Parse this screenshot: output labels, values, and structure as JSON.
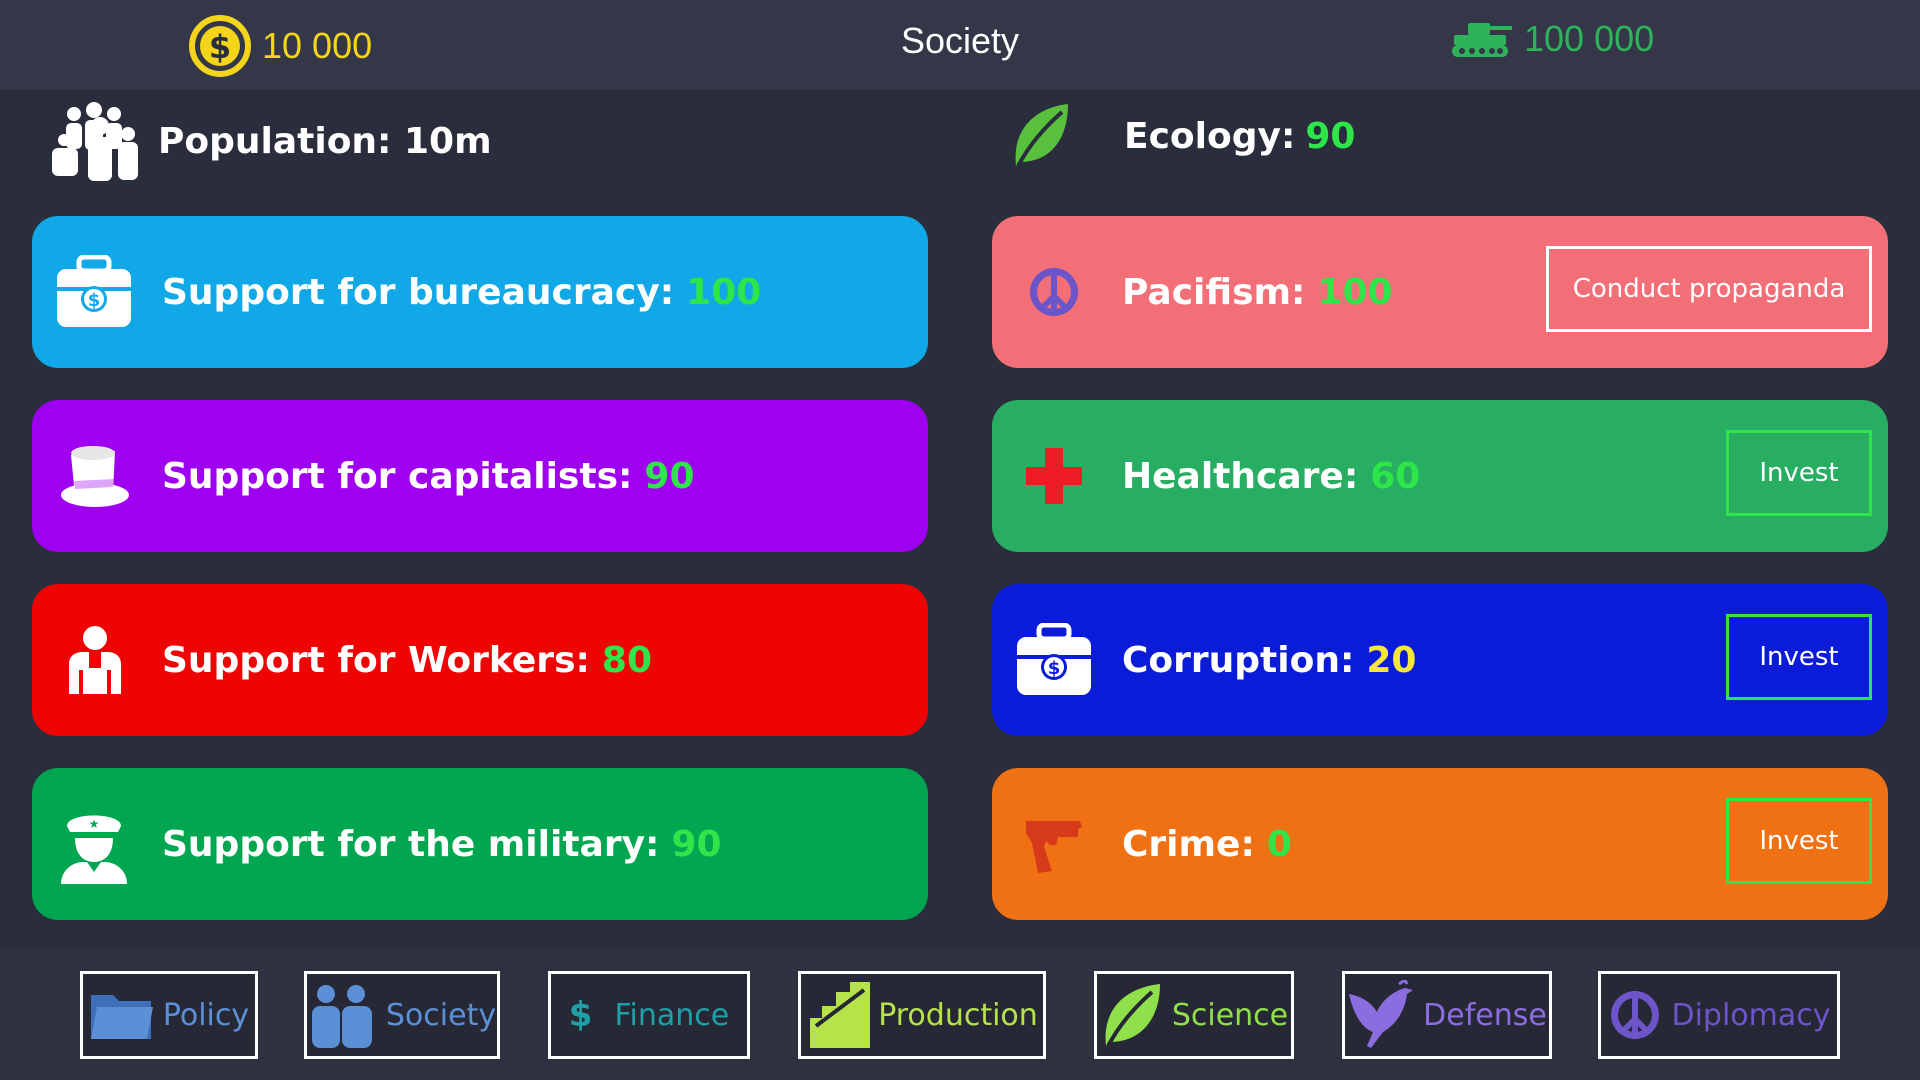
{
  "header": {
    "coins": "10 000",
    "title": "Society",
    "army": "100 000"
  },
  "stats": {
    "population": {
      "label": "Population: 10m"
    },
    "ecology": {
      "label": "Ecology:",
      "value": "90"
    }
  },
  "left_cards": [
    {
      "label": "Support for bureaucracy:",
      "value": "100",
      "color": "#10a8e6",
      "icon": "briefcase-icon"
    },
    {
      "label": "Support for capitalists:",
      "value": "90",
      "color": "#a000f0",
      "icon": "top-hat-icon"
    },
    {
      "label": "Support for Workers:",
      "value": "80",
      "color": "#ee0404",
      "icon": "worker-icon"
    },
    {
      "label": "Support for the military:",
      "value": "90",
      "color": "#01a651",
      "icon": "officer-icon"
    }
  ],
  "right_cards": [
    {
      "label": "Pacifism:",
      "value": "100",
      "color": "#f26f78",
      "button": "Conduct propaganda",
      "icon": "peace-icon"
    },
    {
      "label": "Healthcare:",
      "value": "60",
      "color": "#27ae62",
      "button": "Invest",
      "icon": "medical-cross-icon"
    },
    {
      "label": "Corruption:",
      "value": "20",
      "color": "#0a1cd8",
      "button": "Invest",
      "icon": "briefcase-icon"
    },
    {
      "label": "Crime:",
      "value": "0",
      "color": "#f07014",
      "button": "Invest",
      "icon": "gun-icon"
    }
  ],
  "value_colors": {
    "green": "#2ee64a",
    "yellow": "#f5e63a"
  },
  "tabs": [
    {
      "label": "Policy",
      "color": "#5b8fd6",
      "icon": "folder-icon"
    },
    {
      "label": "Society",
      "color": "#5b8fd6",
      "icon": "people-icon"
    },
    {
      "label": "Finance",
      "color": "#1fa0a8",
      "icon": "dollar-icon"
    },
    {
      "label": "Production",
      "color": "#b7e34a",
      "icon": "production-icon"
    },
    {
      "label": "Science",
      "color": "#8fe04a",
      "icon": "leaf-icon"
    },
    {
      "label": "Defense",
      "color": "#8b6de0",
      "icon": "dove-icon"
    },
    {
      "label": "Diplomacy",
      "color": "#6b55c8",
      "icon": "peace-icon"
    }
  ]
}
